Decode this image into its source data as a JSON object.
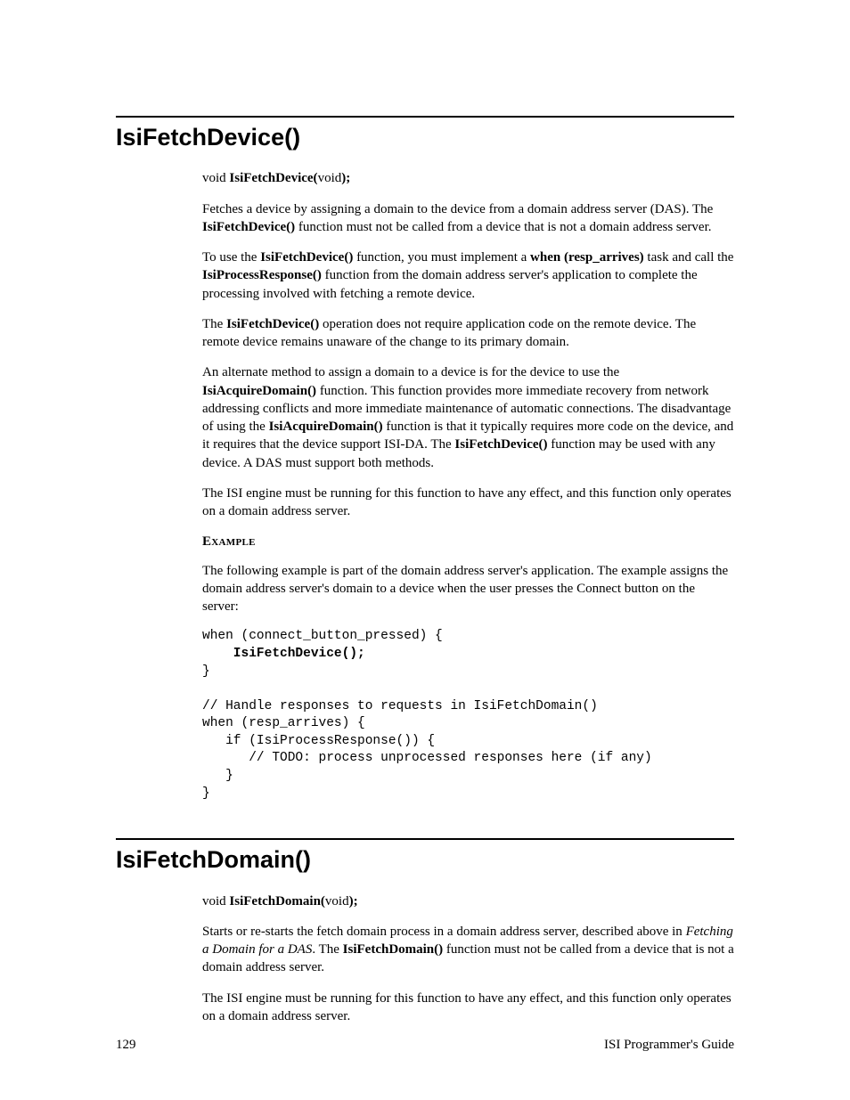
{
  "s1": {
    "heading": "IsiFetchDevice()",
    "sig_pre": "void ",
    "sig_bold": "IsiFetchDevice(",
    "sig_post": "void",
    "sig_close": ");",
    "p1a": "Fetches a device by assigning a domain to the device from a domain address server (DAS).  The ",
    "p1b": "IsiFetchDevice()",
    "p1c": " function must not be called from a device that is not a domain address server.",
    "p2a": "To use the ",
    "p2b": "IsiFetchDevice()",
    "p2c": " function, you must implement a ",
    "p2d": "when (resp_arrives)",
    "p2e": " task and call the ",
    "p2f": "IsiProcessResponse()",
    "p2g": " function from the domain address server's application to complete the processing involved with fetching a remote device.",
    "p3a": "The ",
    "p3b": "IsiFetchDevice()",
    "p3c": " operation does not require application code on the remote device.  The remote device remains unaware of the change to its primary domain.",
    "p4a": "An alternate method to assign a domain to a device is for the device to use the ",
    "p4b": "IsiAcquireDomain()",
    "p4c": " function.  This function provides more immediate recovery from network addressing conflicts and more immediate maintenance of automatic connections.  The disadvantage of using the ",
    "p4d": "IsiAcquireDomain()",
    "p4e": " function is that it typically requires more code on the device, and it requires that the device support ISI-DA.  The ",
    "p4f": "IsiFetchDevice()",
    "p4g": " function may be used with any device.  A DAS must support both methods.",
    "p5": "The ISI engine must be running for this function to have any effect, and this function only operates on a domain address server.",
    "example_label": "Example",
    "p6": "The following example is part of the domain address server's application.  The example assigns the domain address server's domain to a device when the user presses the Connect button on the server:",
    "code": "when (connect_button_pressed) {\n    IsiFetchDevice();\n}\n\n// Handle responses to requests in IsiFetchDomain()\nwhen (resp_arrives) {\n   if (IsiProcessResponse()) {\n      // TODO: process unprocessed responses here (if any)\n   }\n}",
    "code_l1": "when (connect_button_pressed) {",
    "code_l2": "    IsiFetchDevice();",
    "code_l3": "}",
    "code_l4": "",
    "code_l5": "// Handle responses to requests in IsiFetchDomain()",
    "code_l6": "when (resp_arrives) {",
    "code_l7": "   if (IsiProcessResponse()) {",
    "code_l8": "      // TODO: process unprocessed responses here (if any)",
    "code_l9": "   }",
    "code_l10": "}"
  },
  "s2": {
    "heading": "IsiFetchDomain()",
    "sig_pre": "void ",
    "sig_bold": "IsiFetchDomain(",
    "sig_post": "void",
    "sig_close": ");",
    "p1a": "Starts or re-starts the fetch domain process in a domain address server, described above in ",
    "p1b": "Fetching a Domain for a DAS",
    "p1c": ".  The ",
    "p1d": "IsiFetchDomain()",
    "p1e": " function must not be called from a device that is not a domain address server.",
    "p2": "The ISI engine must be running for this function to have any effect, and this function only operates on a domain address server."
  },
  "footer": {
    "page": "129",
    "title": "ISI Programmer's Guide"
  }
}
